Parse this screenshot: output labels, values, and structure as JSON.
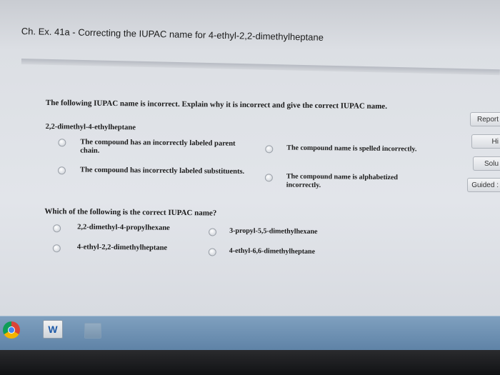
{
  "header": {
    "title": "Ch. Ex. 41a - Correcting the IUPAC name for 4-ethyl-2,2-dimethylheptane"
  },
  "part1": {
    "question": "The following IUPAC name is incorrect. Explain why it is incorrect and give the correct IUPAC name.",
    "compound": "2,2-dimethyl-4-ethylheptane",
    "options": [
      "The compound has an incorrectly labeled parent chain.",
      "The compound name is spelled incorrectly.",
      "The compound has incorrectly labeled substituents.",
      "The compound name is alphabetized incorrectly."
    ]
  },
  "part2": {
    "question": "Which of the following is the correct IUPAC name?",
    "options": [
      "2,2-dimethyl-4-propylhexane",
      "3-propyl-5,5-dimethylhexane",
      "4-ethyl-2,2-dimethylheptane",
      "4-ethyl-6,6-dimethylheptane"
    ]
  },
  "sidebar": {
    "buttons": [
      "Report",
      "Hi",
      "Solu",
      "Guided :"
    ]
  },
  "taskbar": {
    "icons": [
      "chrome-icon",
      "word-icon",
      "file-icon"
    ],
    "word_label": "W"
  }
}
